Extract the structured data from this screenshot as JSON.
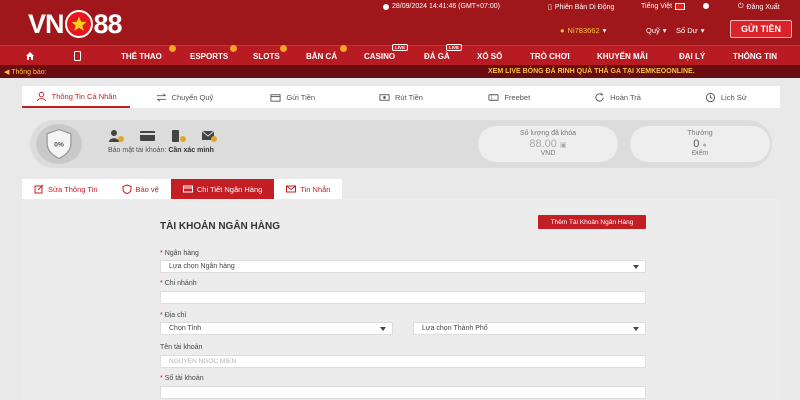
{
  "brand": {
    "left": "VN",
    "right": "88"
  },
  "topinfo": {
    "datetime": "28/09/2024 14:41:46 (GMT+07:00)",
    "mobile": "Phiên Bản Di Động",
    "language": "Tiếng Việt",
    "logout": "Đăng Xuất"
  },
  "user": {
    "name": "Ni783662",
    "fund": "Quỹ",
    "balance": "Số Dư",
    "deposit": "GỬI TIỀN"
  },
  "nav": {
    "items": [
      "THỂ THAO",
      "ESPORTS",
      "SLOTS",
      "BẮN CÁ",
      "CASINO",
      "ĐÁ GÀ",
      "XỔ SỐ",
      "TRÒ CHƠI",
      "KHUYẾN MÃI",
      "ĐẠI LÝ",
      "THÔNG TIN"
    ],
    "live": "LIVE"
  },
  "notice": {
    "label": "Thông báo:",
    "message": "XEM LIVE BÓNG ĐÁ RINH QUÀ THẢ GA TẠI XEMKEOONLINE."
  },
  "main_tabs": [
    "Thông Tin Cá Nhân",
    "Chuyển Quỹ",
    "Gửi Tiền",
    "Rút Tiền",
    "Freebet",
    "Hoàn Trả",
    "Lịch Sử"
  ],
  "security": {
    "percent": "0%",
    "label": "Bảo mật tài khoản:",
    "status": "Cần xác minh",
    "locked_title": "Số lượng đã khóa",
    "locked_value": "88.00",
    "locked_unit": "VND",
    "reward_title": "Thưởng",
    "reward_value": "0",
    "reward_unit": "Điểm"
  },
  "sub_tabs": [
    "Sửa Thông Tin",
    "Bảo vệ",
    "Chi Tiết Ngân Hàng",
    "Tin Nhắn"
  ],
  "form": {
    "title": "TÀI KHOẢN NGÂN HÀNG",
    "add_button": "Thêm Tài Khoản Ngân Hàng",
    "bank_label": "Ngân hàng",
    "bank_value": "Lựa chọn Ngân hàng",
    "branch_label": "Chi nhánh",
    "address_label": "Địa chỉ",
    "province_value": "Chọn Tỉnh",
    "city_value": "Lựa chọn Thành Phố",
    "holder_label": "Tên tài khoản",
    "holder_placeholder": "NGUYEN NGOC MIEN",
    "account_label": "Số tài khoản",
    "required": "*"
  },
  "colors": {
    "brand_red": "#a0171b",
    "accent": "#c41e25",
    "gold": "#f6c343"
  }
}
